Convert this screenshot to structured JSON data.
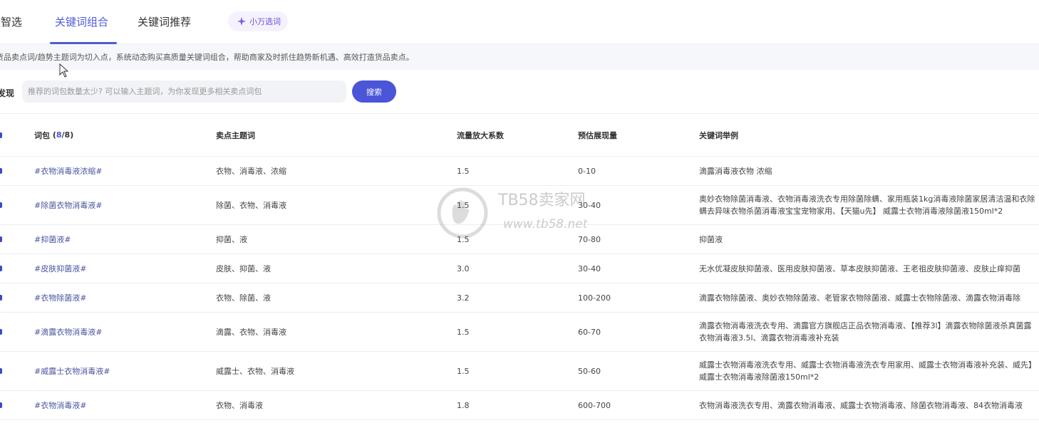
{
  "tabs": [
    {
      "label": "量智选"
    },
    {
      "label": "关键词组合"
    },
    {
      "label": "关键词推荐"
    }
  ],
  "badge": {
    "label": "小万选词"
  },
  "info": {
    "text": "货品卖点词/趋势主题词为切入点，系统动态购买高质量关键词组合，帮助商家及时抓住趋势新机遇、高效打造货品卖点。"
  },
  "search": {
    "label": "发现",
    "placeholder": "推荐的词包数量太少? 可以输入主题词，为你发现更多相关卖点词包",
    "button": "搜索"
  },
  "table": {
    "headers": {
      "package": "词包",
      "count_open": "(",
      "count_selected": "8",
      "count_total": "/8)",
      "theme": "卖点主题词",
      "factor": "流量放大系数",
      "exposure": "预估展现量",
      "example": "关键词举例"
    },
    "rows": [
      {
        "package": "#衣物消毒液浓缩#",
        "theme": "衣物、消毒液、浓缩",
        "factor": "1.5",
        "exposure": "0-10",
        "example": "滴露消毒液衣物 浓缩"
      },
      {
        "package": "#除菌衣物消毒液#",
        "theme": "除菌、衣物、消毒液",
        "factor": "1.5",
        "exposure": "30-40",
        "example": "奥妙衣物除菌消毒液、衣物消毒液洗衣专用除菌除螨、家用瓶装1kg消毒液除菌家居清洁温和衣除螨去异味衣物杀菌消毒液宝宝宠物家用、【天猫u先】 威露士衣物消毒液除菌液150ml*2"
      },
      {
        "package": "#抑菌液#",
        "theme": "抑菌、液",
        "factor": "1.5",
        "exposure": "70-80",
        "example": "抑菌液"
      },
      {
        "package": "#皮肤抑菌液#",
        "theme": "皮肤、抑菌、液",
        "factor": "3.0",
        "exposure": "30-40",
        "example": "无水优凝皮肤抑菌液、医用皮肤抑菌液、草本皮肤抑菌液、王老祖皮肤抑菌液、皮肤止痒抑菌"
      },
      {
        "package": "#衣物除菌液#",
        "theme": "衣物、除菌、液",
        "factor": "3.2",
        "exposure": "100-200",
        "example": "滴露衣物除菌液、奥妙衣物除菌液、老管家衣物除菌液、威露士衣物除菌液、滴露衣物消毒除"
      },
      {
        "package": "#滴露衣物消毒液#",
        "theme": "滴露、衣物、消毒液",
        "factor": "1.5",
        "exposure": "60-70",
        "example": "滴露衣物消毒液洗衣专用、滴露官方旗舰店正品衣物消毒液、【推荐3l】滴露衣物除菌液杀真菌露衣物消毒液3.5l、滴露衣物消毒液补充装"
      },
      {
        "package": "#威露士衣物消毒液#",
        "theme": "威露士、衣物、消毒液",
        "factor": "1.5",
        "exposure": "50-60",
        "example": "威露士衣物消毒液洗衣专用、威露士衣物消毒液洗衣专用家用、威露士衣物消毒液补充装、威先】 威露士衣物消毒液除菌液150ml*2"
      },
      {
        "package": "#衣物消毒液#",
        "theme": "衣物、消毒液",
        "factor": "1.8",
        "exposure": "600-700",
        "example": "衣物消毒液洗衣专用、滴露衣物消毒液、威露士衣物消毒液、除菌衣物消毒液、84衣物消毒液"
      }
    ]
  },
  "watermark": {
    "line1": "TB58卖家网",
    "line2": "www.tb58.net"
  },
  "colors": {
    "accent": "#4f5bd5",
    "button": "#4a55d8",
    "tag": "#4a55a0"
  },
  "icons": {
    "cursor": "arrow-cursor-icon",
    "badge": "sparkle-icon",
    "checkbox": "checkbox-icon",
    "watermark": "hand-logo-icon"
  }
}
